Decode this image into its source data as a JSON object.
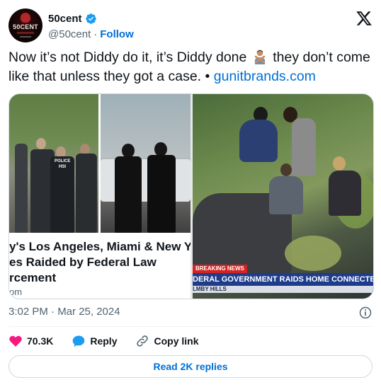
{
  "account": {
    "name": "50cent",
    "handle": "@50cent",
    "separator": "·",
    "follow_label": "Follow",
    "avatar_text": "50CENT",
    "verified_color": "#1d9bf0"
  },
  "brand": {
    "logo_icon": "x-logo-icon"
  },
  "tweet": {
    "text_before_emoji": "Now it’s not Diddy do it, it’s Diddy done",
    "emoji": "man-gesturing-no-emoji",
    "text_after_emoji": "they don’t come like that unless they got a case. •",
    "link": "gunitbrands.com"
  },
  "media": {
    "card": {
      "vest_label": "POLICE",
      "vest_sub": "HSI",
      "headline_line1": "y's Los Angeles, Miami & New Y",
      "headline_line2": "es Raided by Federal Law",
      "headline_line3": "rcement",
      "source": "om"
    },
    "video": {
      "breaking_label": "BREAKING NEWS",
      "lower_third": "DERAL GOVERNMENT RAIDS HOME CONNECTED",
      "lower_sub": "LMBY HILLS"
    }
  },
  "meta": {
    "timestamp": "3:02 PM · Mar 25, 2024",
    "info_icon": "info-icon"
  },
  "actions": {
    "likes_count": "70.3K",
    "reply_label": "Reply",
    "copy_link_label": "Copy link",
    "like_color": "#f91880",
    "reply_color": "#1d9bf0"
  },
  "footer": {
    "read_replies_label": "Read 2K replies"
  }
}
